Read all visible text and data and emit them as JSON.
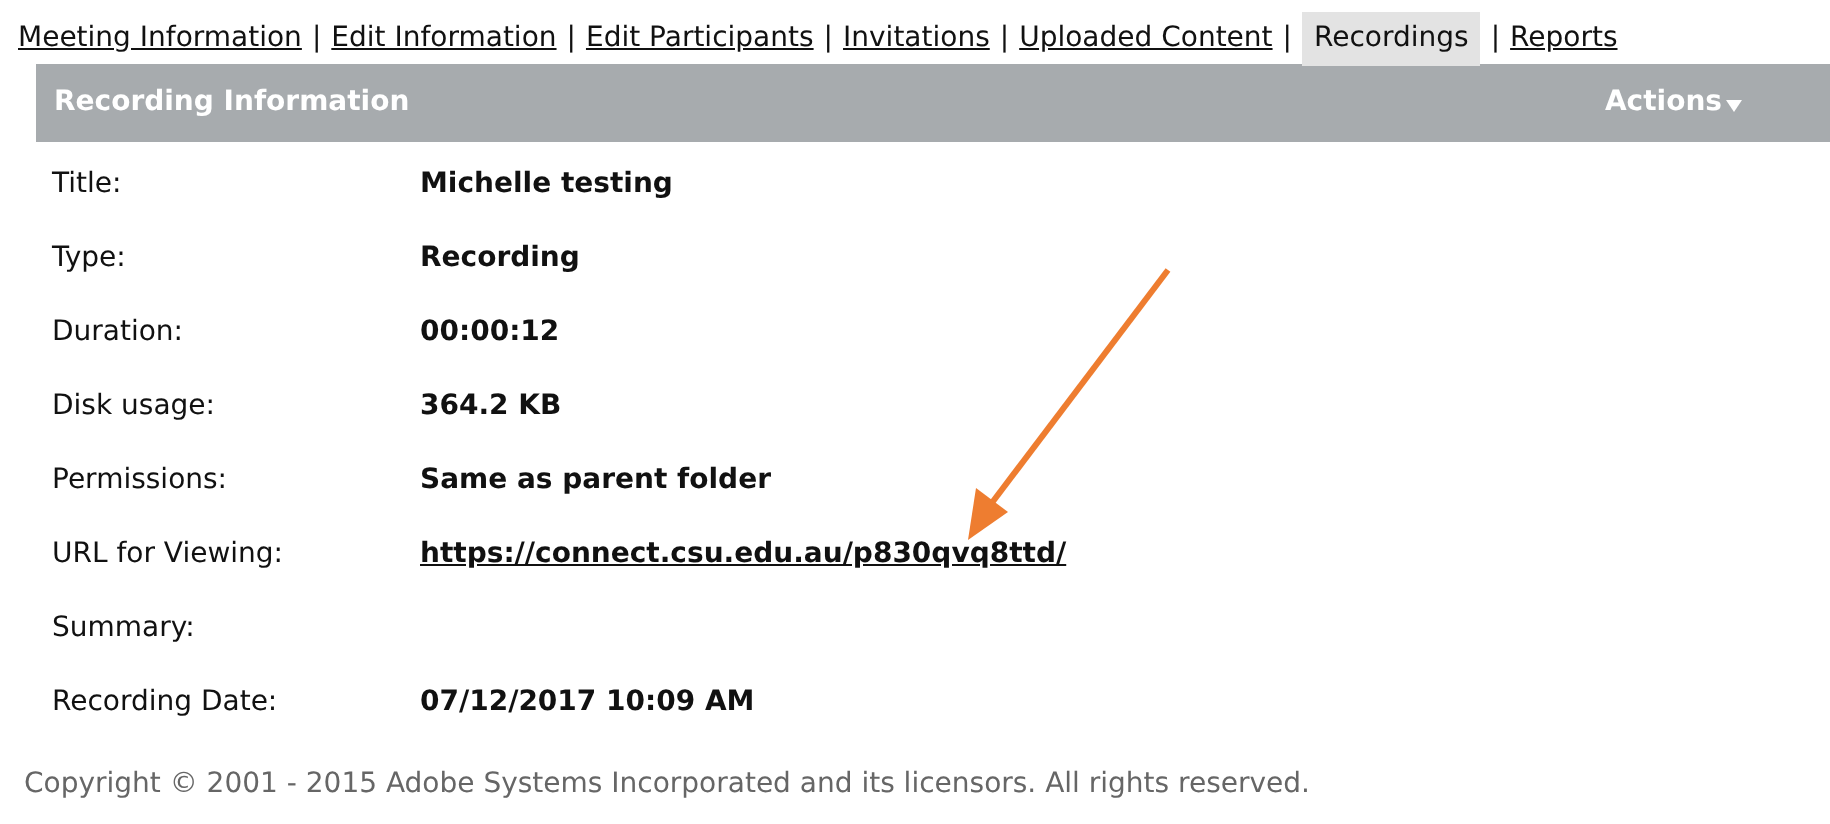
{
  "tabs": [
    {
      "label": "Meeting Information",
      "selected": false
    },
    {
      "label": "Edit Information",
      "selected": false
    },
    {
      "label": "Edit Participants",
      "selected": false
    },
    {
      "label": "Invitations",
      "selected": false
    },
    {
      "label": "Uploaded Content",
      "selected": false
    },
    {
      "label": "Recordings",
      "selected": true
    },
    {
      "label": "Reports",
      "selected": false
    }
  ],
  "tab_separator": "|",
  "panel": {
    "title": "Recording Information",
    "actions": "Actions",
    "rows": [
      {
        "label": "Title:",
        "value": "Michelle testing",
        "kind": "text"
      },
      {
        "label": "Type:",
        "value": "Recording",
        "kind": "text"
      },
      {
        "label": "Duration:",
        "value": "00:00:12",
        "kind": "text"
      },
      {
        "label": "Disk usage:",
        "value": "364.2 KB",
        "kind": "text"
      },
      {
        "label": "Permissions:",
        "value": "Same as parent folder",
        "kind": "text"
      },
      {
        "label": "URL for Viewing:",
        "value": "https://connect.csu.edu.au/p830qvq8ttd/",
        "kind": "link"
      },
      {
        "label": "Summary:"
      },
      {
        "label": "Recording Date:",
        "value": "07/12/2017 10:09 AM",
        "kind": "text"
      }
    ]
  },
  "footer": "Copyright © 2001 - 2015 Adobe Systems Incorporated and its licensors. All rights reserved."
}
